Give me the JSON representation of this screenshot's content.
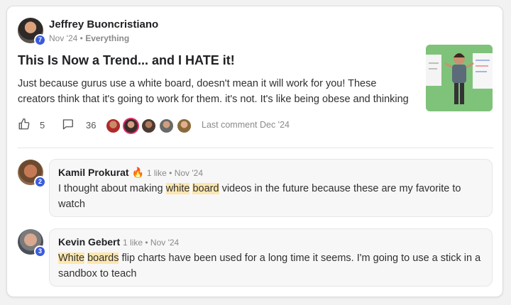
{
  "post": {
    "author": "Jeffrey Buoncristiano",
    "author_level": "7",
    "date": "Nov '24",
    "separator": " • ",
    "category": "Everything",
    "title": "This Is Now a Trend... and I HATE it!",
    "body_lines": [
      "Just because gurus use a white board, doesn't mean it will work for you! These",
      "creators think that it's going to work for them. it's not. It's like being obese and thinking"
    ],
    "likes": "5",
    "comments": "36",
    "last_comment": "Last comment Dec '24"
  },
  "comments": [
    {
      "author": "Kamil Prokurat",
      "emoji": "🔥",
      "level": "2",
      "meta": "1 like • Nov '24",
      "text_before": "I thought about making ",
      "highlight_1": "white",
      "space": " ",
      "highlight_2": "board",
      "text_after": " videos in the future because these are my favorite to watch"
    },
    {
      "author": "Kevin Gebert",
      "level": "3",
      "meta": "1 like • Nov '24",
      "highlight_1": "White",
      "space": " ",
      "highlight_2": "boards",
      "text_after": " flip charts have been used for a long time it seems. I'm going to use a stick in a sandbox to teach"
    }
  ],
  "colors": {
    "level_badge": "#3b5bdb",
    "highlight": "#fde7b0",
    "thumbnail_bg": "#7fc27a"
  },
  "icons": {
    "like": "thumbs-up-icon",
    "comment": "comment-bubble-icon"
  }
}
